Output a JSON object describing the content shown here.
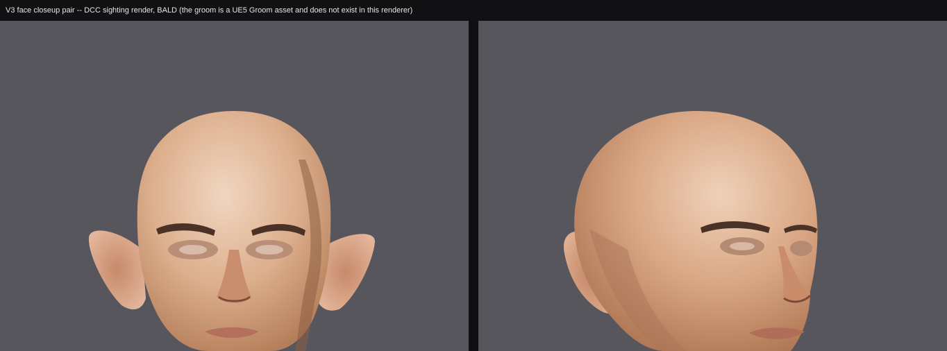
{
  "window": {
    "title": "V3 face closeup pair -- DCC sighting render, BALD (the groom is a UE5 Groom asset and does not exist in this renderer)"
  },
  "viewports": [
    {
      "view": "front"
    },
    {
      "view": "three-quarter"
    }
  ],
  "colors": {
    "background": "#56565c",
    "titlebar": "#111114",
    "divider": "#101012",
    "skin_light": "#e8c7ad",
    "skin_mid": "#cf9a78",
    "skin_dark": "#8a5a3e"
  }
}
